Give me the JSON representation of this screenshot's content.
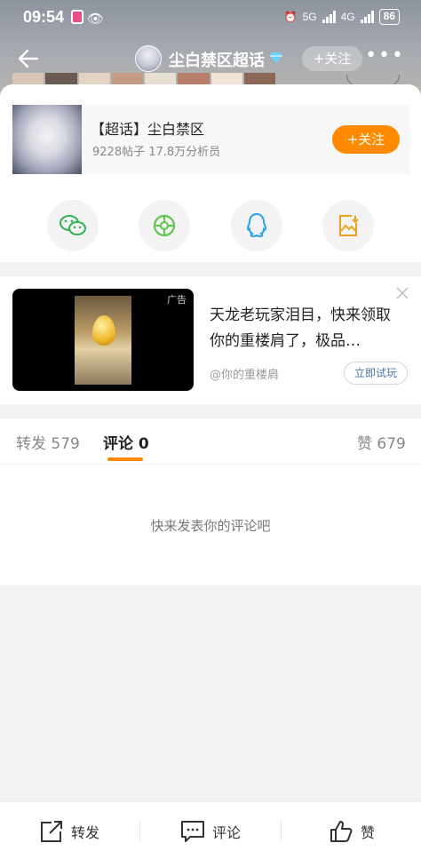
{
  "status_bar": {
    "time": "09:54",
    "network1": "5G",
    "network2": "4G",
    "battery": "86"
  },
  "header": {
    "title": "尘白禁区超话",
    "follow_label": "+关注"
  },
  "topic_card": {
    "name": "【超话】尘白禁区",
    "posts": "9228帖子",
    "members": "17.8万分析员",
    "join_label": "+关注"
  },
  "share_icons": [
    "wechat-icon",
    "moments-icon",
    "qq-icon",
    "save-image-icon"
  ],
  "ad": {
    "tag": "广告",
    "headline": "天龙老玩家泪目，快来领取你的重楼肩了，极品…",
    "source": "@你的重楼肩",
    "cta": "立即试玩"
  },
  "tabs": [
    {
      "label": "转发",
      "count": "579"
    },
    {
      "label": "评论",
      "count": "0"
    },
    {
      "label": "赞",
      "count": "679"
    }
  ],
  "empty_message": "快来发表你的评论吧",
  "bottom_bar": {
    "repost": "转发",
    "comment": "评论",
    "like": "赞"
  },
  "colors": {
    "accent": "#ff8a00",
    "link": "#4a76a8"
  }
}
